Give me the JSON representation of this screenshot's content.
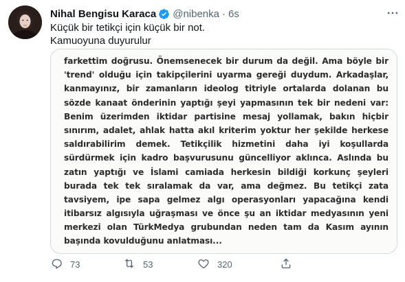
{
  "tweet": {
    "display_name": "Nihal Bengisu Karaca",
    "handle": "@nibenka",
    "separator": "·",
    "time": "6s",
    "text_lines": [
      "Küçük bir tetikçi için küçük bir not.",
      "Kamuoyuna duyurulur"
    ],
    "icons": {
      "verified": "verified-badge-icon",
      "more": "more-options-icon",
      "reply": "reply-icon",
      "retweet": "retweet-icon",
      "like": "like-icon",
      "share": "share-icon"
    },
    "colors": {
      "verified": "#1d9bf0",
      "secondary_text": "#536471",
      "border": "#cfd9de"
    }
  },
  "media": {
    "lines": [
      "farkettim doğrusu. Önemsenecek bir durum da değil. Ama böyle bir",
      "'trend' olduğu için takipçilerini uyarma gereği duydum. Arkadaşlar,",
      "kanmayınız, bir zamanların ideolog titriyle ortalarda dolanan bu",
      "sözde kanaat önderinin yaptığı şeyi yapmasının tek bir nedeni var:",
      "Benim üzerimden iktidar partisine mesaj yollamak, bakın hiçbir",
      "sınırım, adalet, ahlak hatta akıl kriterim yoktur her şekilde herkese",
      "saldırabilirim demek. Tetikçilik hizmetini daha iyi koşullarda",
      "sürdürmek için kadro başvurusunu güncelliyor aklınca. Aslında bu",
      "zatın yaptığı ve İslami camiada herkesin bildiği korkunç şeyleri",
      "burada tek tek sıralamak da var, ama değmez. Bu tetikçi zata",
      "tavsiyem,  ipe sapa gelmez algı operasyonları yapacağına kendi",
      "itibarsız algısıyla uğraşması ve önce şu an iktidar medyasının yeni",
      "merkezi olan TürkMedya grubundan neden tam da Kasım ayının",
      "başında kovulduğunu anlatması..."
    ]
  },
  "actions": {
    "reply_count": "73",
    "retweet_count": "53",
    "like_count": "320"
  }
}
